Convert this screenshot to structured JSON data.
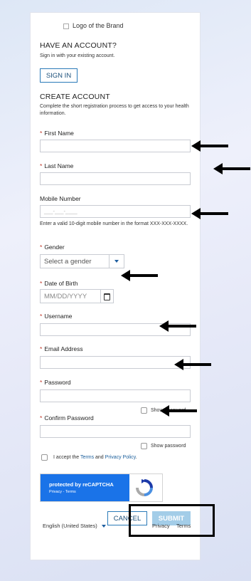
{
  "logo_alt": "Logo of the Brand",
  "have_account": {
    "title": "HAVE AN ACCOUNT?",
    "subtitle": "Sign in with your existing account.",
    "signin_label": "SIGN IN"
  },
  "create_account": {
    "title": "CREATE ACCOUNT",
    "subtitle": "Complete the short registration process to get access to your health information."
  },
  "fields": {
    "first_name": {
      "label": "First Name",
      "required_mark": "*",
      "value": ""
    },
    "last_name": {
      "label": "Last Name",
      "required_mark": "*",
      "value": ""
    },
    "mobile": {
      "label": "Mobile Number",
      "mask": "___-___-____",
      "help": "Enter a valid 10-digit mobile number in the format XXX-XXX-XXXX."
    },
    "gender": {
      "label": "Gender",
      "required_mark": "*",
      "placeholder": "Select a gender"
    },
    "dob": {
      "label": "Date of Birth",
      "required_mark": "*",
      "placeholder": "MM/DD/YYYY"
    },
    "username": {
      "label": "Username",
      "required_mark": "*",
      "value": ""
    },
    "email": {
      "label": "Email Address",
      "required_mark": "*",
      "value": ""
    },
    "password": {
      "label": "Password",
      "required_mark": "*",
      "show_label": "Show password"
    },
    "confirm_password": {
      "label": "Confirm Password",
      "required_mark": "*",
      "show_label": "Show password"
    }
  },
  "terms": {
    "prefix": "I accept the ",
    "terms_link": "Terms",
    "and": " and ",
    "privacy_link": "Privacy Policy",
    "suffix": "."
  },
  "recaptcha": {
    "title": "protected by reCAPTCHA",
    "links": "Privacy - Terms"
  },
  "actions": {
    "cancel_label": "CANCEL",
    "submit_label": "SUBMIT"
  },
  "footer": {
    "language": "English (United States)",
    "privacy": "Privacy",
    "terms": "Terms"
  },
  "colors": {
    "accent": "#1b5f9c",
    "submit_bg": "#a3cde8",
    "required": "#c0392b",
    "recaptcha_blue": "#1a73e8"
  }
}
